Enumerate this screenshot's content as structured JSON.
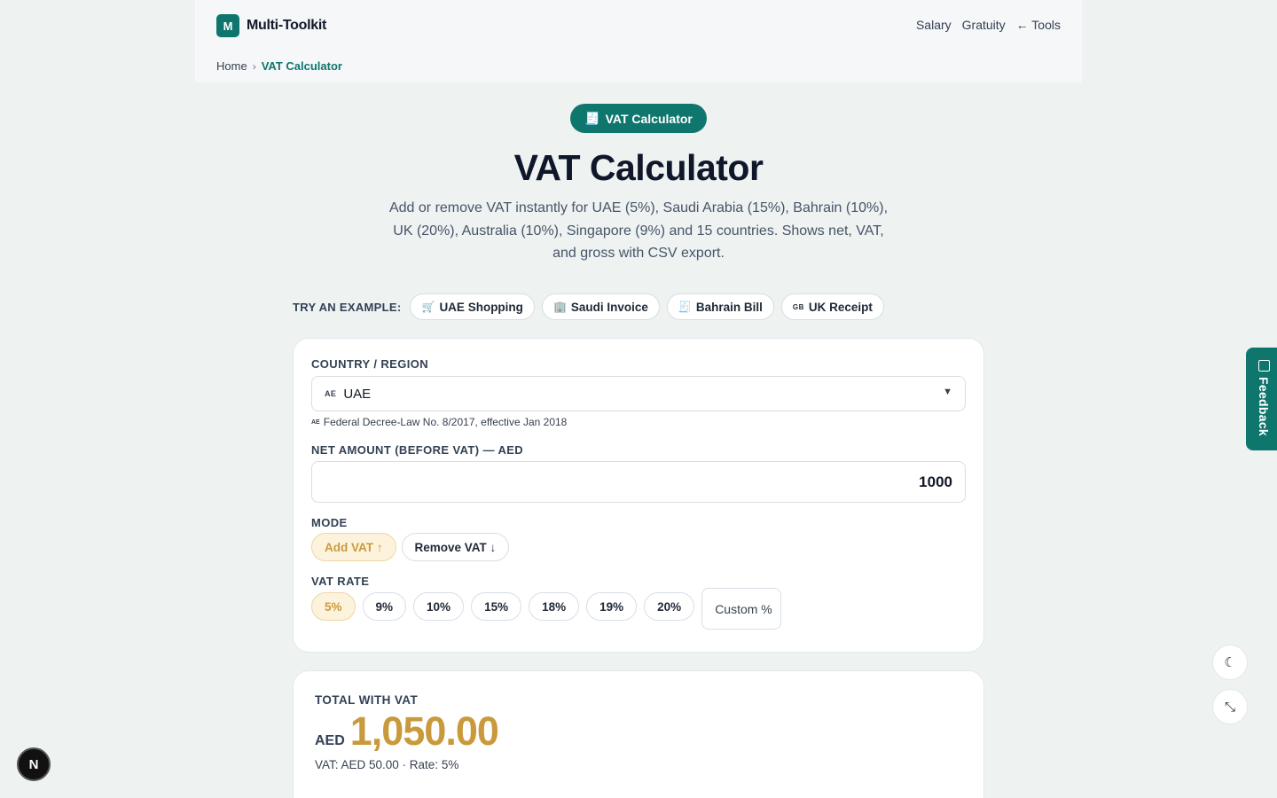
{
  "header": {
    "logo_letter": "M",
    "brand": "Multi-Toolkit",
    "nav": [
      "Salary",
      "Gratuity",
      "← Tools"
    ]
  },
  "breadcrumb": {
    "home": "Home",
    "separator": "›",
    "current": "VAT Calculator"
  },
  "hero": {
    "badge_icon": "🧾",
    "badge_label": "VAT Calculator",
    "title": "VAT Calculator",
    "subtitle": "Add or remove VAT instantly for UAE (5%), Saudi Arabia (15%), Bahrain (10%), UK (20%), Australia (10%), Singapore (9%) and 15 countries. Shows net, VAT, and gross with CSV export."
  },
  "examples": {
    "label": "TRY AN EXAMPLE:",
    "items": [
      {
        "icon": "🛒",
        "label": "UAE Shopping"
      },
      {
        "icon": "🏢",
        "label": "Saudi Invoice"
      },
      {
        "icon": "🧾",
        "label": "Bahrain Bill"
      },
      {
        "icon": "GB",
        "label": "UK Receipt"
      }
    ]
  },
  "form": {
    "country_label": "COUNTRY / REGION",
    "country_flag": "AE",
    "country_value": "UAE",
    "country_hint_flag": "AE",
    "country_hint": "Federal Decree-Law No. 8/2017, effective Jan 2018",
    "amount_label": "NET AMOUNT (BEFORE VAT) — AED",
    "amount_value": "1000",
    "mode_label": "MODE",
    "modes": [
      "Add VAT ↑",
      "Remove VAT ↓"
    ],
    "rate_label": "VAT RATE",
    "rates": [
      "5%",
      "9%",
      "10%",
      "15%",
      "18%",
      "19%",
      "20%"
    ],
    "custom_placeholder": "Custom %"
  },
  "result": {
    "label": "TOTAL WITH VAT",
    "currency": "AED",
    "total": "1,050.00",
    "meta": "VAT: AED 50.00 · Rate: 5%"
  },
  "side": {
    "feedback_label": "Feedback",
    "theme_icon": "moon-icon",
    "collapse_icon": "collapse-icon"
  },
  "colors": {
    "primary": "#0f766e",
    "accent": "#c99a3c",
    "active_bg": "#fdf3dc"
  }
}
